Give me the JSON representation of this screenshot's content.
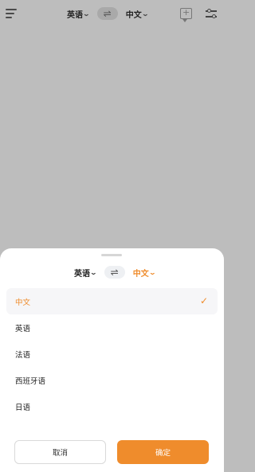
{
  "topbar": {
    "menu_icon": "menu-icon",
    "source_lang": "英语",
    "swap_symbol": "⇌",
    "target_lang": "中文",
    "message_icon": "message-plus-icon",
    "settings_icon": "filter-icon",
    "chevron": "⌄"
  },
  "sheet": {
    "source_lang": "英语",
    "swap_symbol": "⇌",
    "target_lang": "中文",
    "chevron": "⌄",
    "options": [
      {
        "label": "中文",
        "selected": true
      },
      {
        "label": "英语",
        "selected": false
      },
      {
        "label": "法语",
        "selected": false
      },
      {
        "label": "西班牙语",
        "selected": false
      },
      {
        "label": "日语",
        "selected": false
      }
    ],
    "check_mark": "✓",
    "cancel_label": "取消",
    "confirm_label": "确定"
  },
  "colors": {
    "accent": "#ef8c2c",
    "backdrop": "#bdbdbd"
  }
}
